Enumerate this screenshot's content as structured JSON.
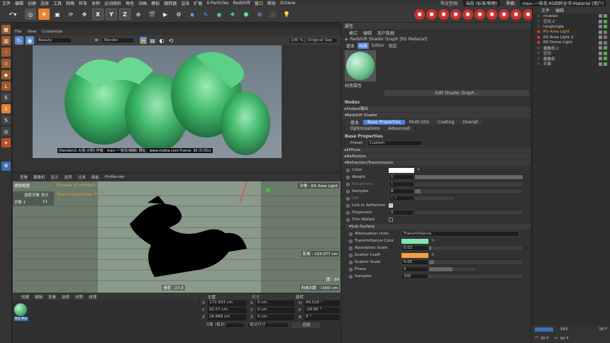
{
  "menubar": {
    "items": [
      "文件",
      "编辑",
      "创建",
      "选择",
      "工具",
      "网格",
      "样条",
      "体积",
      "运动图形",
      "角色",
      "动画",
      "模拟",
      "跟踪器",
      "渲染",
      "扩展",
      "X-Particles",
      "Redshift",
      "窗口",
      "帮助",
      "Octane"
    ],
    "node_space_label": "节点空间:",
    "node_space_value": "当前 (标准/物理)",
    "interface_label": "界面:",
    "interface_value": "max--一枝花-RS四料全书-Material (用户)"
  },
  "toolbar": {
    "axis_x": "X",
    "axis_y": "Y",
    "axis_z": "Z"
  },
  "viewport_top": {
    "menu": [
      "File",
      "View",
      "Customize"
    ],
    "preset": "Beauty",
    "mode": "Render",
    "zoom": "100 %",
    "size": "Original Size",
    "watermark": "[Renders1 大师-大明] 作者：max--一枝花(萌萌) 网址：www.mobia.com  Frame: 30 (0.05s)"
  },
  "viewport_bottom": {
    "menu": [
      "查看",
      "摄像机",
      "显示",
      "选项",
      "过滤",
      "面板",
      "ProRender"
    ],
    "label": "透视视图",
    "camera_label": "对象 : RS Area Light",
    "info_rows": [
      [
        "选取对象 总计",
        ""
      ],
      [
        "对象 1",
        "11"
      ]
    ],
    "emitters": "Number of emitters: 0",
    "particles": "Total live particles: 0",
    "distance": "距离 : 103.077 cm",
    "speed": "速度 : 27.0",
    "grid": "网格间距 : 1000 cm",
    "frame_id": "图 : 30"
  },
  "material_mgr": {
    "menu": [
      "创建",
      "编辑",
      "查看",
      "选择",
      "材质",
      "纹理"
    ],
    "item_label": "RS Ma"
  },
  "coords": {
    "headers": [
      "位置",
      "尺寸",
      "旋转"
    ],
    "rows": [
      {
        "axis": "X",
        "pos": "172.933 cm",
        "size_axis": "X",
        "size": "0 cm",
        "rot_axis": "H",
        "rot": "99.516 °"
      },
      {
        "axis": "Y",
        "pos": "92.57 cm",
        "size_axis": "Y",
        "size": "0 cm",
        "rot_axis": "P",
        "rot": "-29.85 °"
      },
      {
        "axis": "Z",
        "pos": "26.668 cm",
        "size_axis": "Z",
        "size": "0 cm",
        "rot_axis": "B",
        "rot": "0 °"
      }
    ],
    "mode": "对象 (相对)",
    "size_mode": "绝对尺寸",
    "apply": "应用"
  },
  "attributes": {
    "title": "属性",
    "menu": [
      "模式",
      "编辑",
      "用户数据"
    ],
    "object_name": "Redshift Shader Graph [RS Material]",
    "tabs": [
      "基本",
      "材质",
      "Editor",
      "指定"
    ],
    "mat_props": "材质属性",
    "edit_btn": "Edit Shader Graph...",
    "nodes": "Nodes",
    "node_output": "Output输出",
    "node_shader": "Redshift Shader",
    "subtabs": [
      "基本",
      "Base Properties",
      "Multi-SSS",
      "Coating",
      "Overall"
    ],
    "subtabs2": [
      "Optimizations",
      "Advanced"
    ],
    "base_title": "Base Properties",
    "preset_label": "Preset",
    "preset_value": "Custom",
    "sections": [
      "Diffuse",
      "Reflection",
      "Refraction/Transmission"
    ],
    "props": [
      {
        "label": "Color",
        "value": ""
      },
      {
        "label": "Weight",
        "value": "1"
      },
      {
        "label": "Roughness",
        "value": "0"
      },
      {
        "label": "Samples",
        "value": "8"
      },
      {
        "label": "IOR",
        "value": "1.5"
      }
    ],
    "link_reflection": "Link to Reflection",
    "dispersion_label": "Dispersion",
    "dispersion_value": "0",
    "thin_walled": "Thin Walled",
    "subsurface": "Sub-Surface",
    "sub_props": [
      {
        "label": "Attenuation Units",
        "value": "Transmittance"
      },
      {
        "label": "Transmittance Color",
        "value": ""
      },
      {
        "label": "Absorption Scale",
        "value": "0.02"
      },
      {
        "label": "Scatter Coeff",
        "value": ""
      },
      {
        "label": "Scatter Scale",
        "value": "0.05"
      },
      {
        "label": "Phase",
        "value": "0"
      },
      {
        "label": "Samples",
        "value": "300"
      }
    ]
  },
  "objects": {
    "menu": [
      "文件",
      "编辑"
    ],
    "items": [
      "mubiao",
      "空白.2",
      "longlongla",
      "RS Area Light",
      "RS Area Light.3",
      "RS Dome Light",
      "摄像机.1",
      "空白",
      "摄像机",
      "平面"
    ]
  },
  "timeline": {
    "frame1": "30 F",
    "frame2": "90 F",
    "frame3": "38 F",
    "frame4": "583"
  },
  "colors": {
    "transmittance": "#7ee8b0",
    "scatter": "#f0a040",
    "color": "#ffffff",
    "accent": "#4a7fd4"
  }
}
